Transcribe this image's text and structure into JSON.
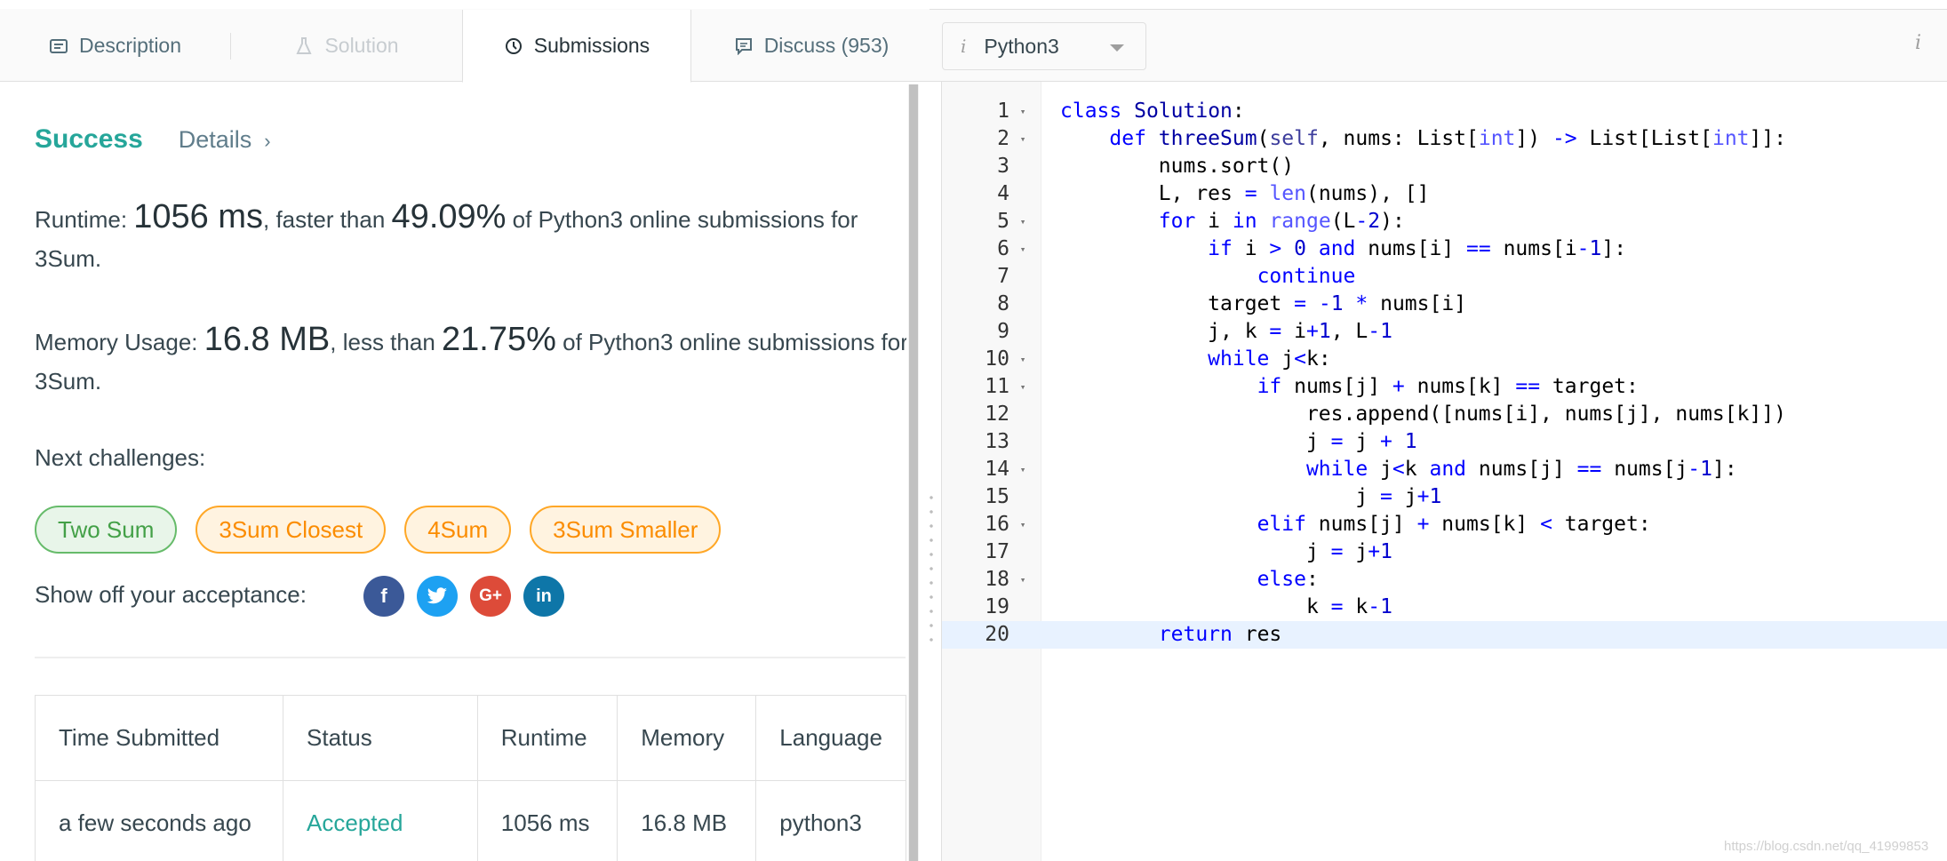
{
  "tabs": {
    "description": "Description",
    "solution": "Solution",
    "submissions": "Submissions",
    "discuss": "Discuss (953)"
  },
  "language_select": {
    "info": "i",
    "value": "Python3"
  },
  "top_info": "i",
  "result": {
    "status": "Success",
    "details": "Details",
    "details_chevron": "›"
  },
  "runtime": {
    "label": "Runtime: ",
    "value": "1056 ms",
    "mid": ", faster than ",
    "percent": "49.09%",
    "tail": " of Python3 online submissions for 3Sum."
  },
  "memory": {
    "label": "Memory Usage: ",
    "value": "16.8 MB",
    "mid": ", less than ",
    "percent": "21.75%",
    "tail": " of Python3 online submissions for 3Sum."
  },
  "next_challenges": {
    "label": "Next challenges:",
    "items": [
      "Two Sum",
      "3Sum Closest",
      "4Sum",
      "3Sum Smaller"
    ]
  },
  "share": {
    "label": "Show off your acceptance:",
    "icons": {
      "facebook": "f",
      "twitter": "t",
      "google": "G+",
      "linkedin": "in"
    }
  },
  "table": {
    "headers": [
      "Time Submitted",
      "Status",
      "Runtime",
      "Memory",
      "Language"
    ],
    "rows": [
      [
        "a few seconds ago",
        "Accepted",
        "1056 ms",
        "16.8 MB",
        "python3"
      ]
    ]
  },
  "editor": {
    "line_numbers": [
      "1",
      "2",
      "3",
      "4",
      "5",
      "6",
      "7",
      "8",
      "9",
      "10",
      "11",
      "12",
      "13",
      "14",
      "15",
      "16",
      "17",
      "18",
      "19",
      "20"
    ],
    "fold_marker": "▾"
  },
  "watermark": "https://blog.csdn.net/qq_41999853",
  "colors": {
    "success": "#26a69a",
    "easy": "#43a047",
    "medium": "#fb8c00",
    "keyword": "#0000ff"
  }
}
